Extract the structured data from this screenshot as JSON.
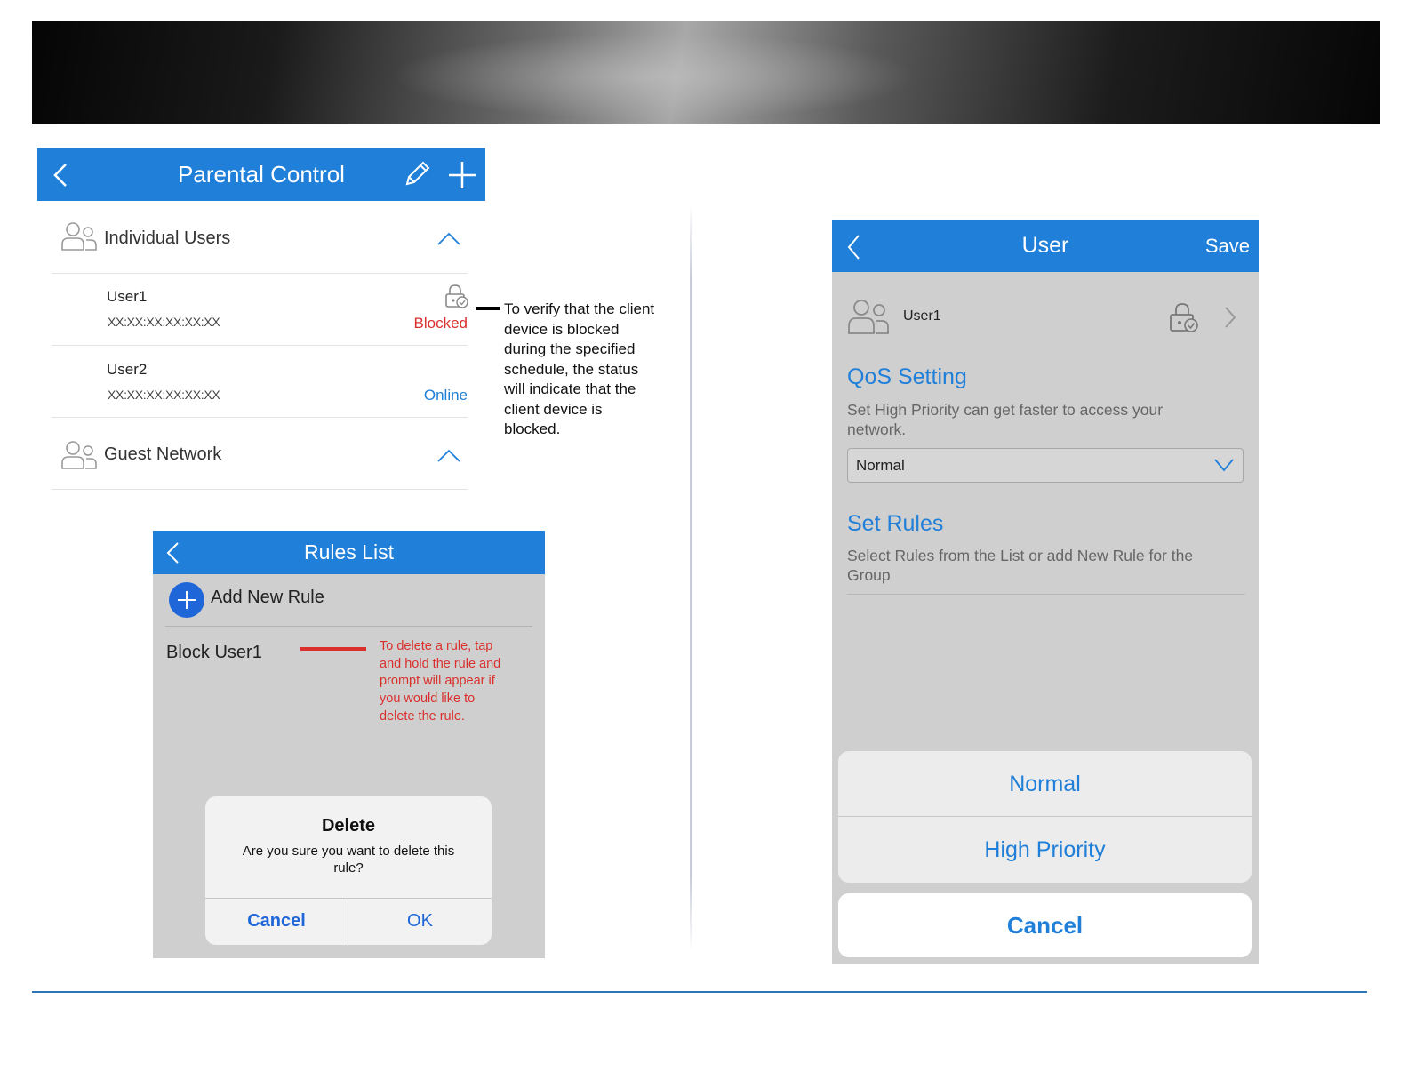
{
  "parental_control": {
    "title": "Parental Control",
    "section_individual": "Individual Users",
    "users": [
      {
        "name": "User1",
        "mac": "XX:XX:XX:XX:XX:XX",
        "status": "Blocked"
      },
      {
        "name": "User2",
        "mac": "XX:XX:XX:XX:XX:XX",
        "status": "Online"
      }
    ],
    "section_guest": "Guest Network"
  },
  "callout_note": "To verify that the client device is blocked during the specified schedule, the status will indicate that the client device is blocked.",
  "rules_list": {
    "title": "Rules List",
    "add_new_rule": "Add New Rule",
    "rule": "Block User1",
    "note": "To delete a rule, tap and hold the rule and prompt will appear if you would like to delete the rule.",
    "dialog": {
      "title": "Delete",
      "message": "Are you sure you want to delete this rule?",
      "cancel": "Cancel",
      "ok": "OK"
    }
  },
  "user_screen": {
    "title": "User",
    "save": "Save",
    "username": "User1",
    "qos_heading": "QoS Setting",
    "qos_desc": "Set High Priority can get faster to access your network.",
    "qos_value": "Normal",
    "rules_heading": "Set Rules",
    "rules_desc": "Select Rules from the List or add New Rule for the Group",
    "sheet_options": [
      "Normal",
      "High Priority"
    ],
    "sheet_cancel": "Cancel"
  },
  "colors": {
    "header_blue": "#1f7fd9",
    "blocked_red": "#d9302c",
    "panel_gray": "#cfcfcf",
    "rule_line": "#2e75b6"
  }
}
